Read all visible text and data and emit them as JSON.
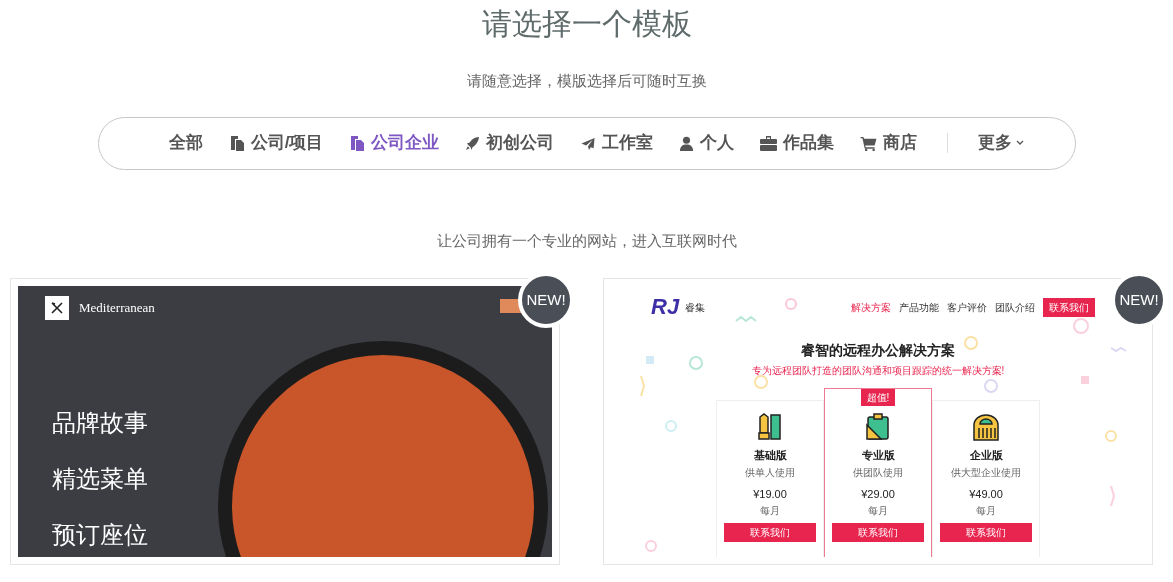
{
  "heading": "请选择一个模板",
  "subheading": "请随意选择，模版选择后可随时互换",
  "filters": [
    {
      "label": "全部",
      "selected": false
    },
    {
      "label": "公司/项目",
      "selected": false
    },
    {
      "label": "公司企业",
      "selected": true
    },
    {
      "label": "初创公司",
      "selected": false
    },
    {
      "label": "工作室",
      "selected": false
    },
    {
      "label": "个人",
      "selected": false
    },
    {
      "label": "作品集",
      "selected": false
    },
    {
      "label": "商店",
      "selected": false
    }
  ],
  "more": "更多",
  "category_tagline": "让公司拥有一个专业的网站，进入互联网时代",
  "templates": [
    {
      "kind": "restaurant",
      "badge": "NEW!",
      "brand": "Mediterranean",
      "menu": [
        "品牌故事",
        "精选菜单",
        "预订座位"
      ]
    },
    {
      "kind": "saas",
      "badge": "NEW!",
      "logo": "RJ",
      "brand": "睿集",
      "nav": [
        {
          "label": "解决方案",
          "selected": true
        },
        {
          "label": "产品功能",
          "selected": false
        },
        {
          "label": "客户评价",
          "selected": false
        },
        {
          "label": "团队介绍",
          "selected": false
        }
      ],
      "cta": "联系我们",
      "headline": "睿智的远程办公解决方案",
      "tagline": "专为远程团队打造的团队沟通和项目跟踪的统一解决方案!",
      "plans": [
        {
          "name": "基础版",
          "desc": "供单人使用",
          "price": "¥19.00",
          "period": "每月",
          "button": "联系我们",
          "featured": false
        },
        {
          "name": "专业版",
          "desc": "供团队使用",
          "price": "¥29.00",
          "period": "每月",
          "button": "联系我们",
          "featured": true,
          "ribbon": "超值!"
        },
        {
          "name": "企业版",
          "desc": "供大型企业使用",
          "price": "¥49.00",
          "period": "每月",
          "button": "联系我们",
          "featured": false
        }
      ]
    }
  ]
}
